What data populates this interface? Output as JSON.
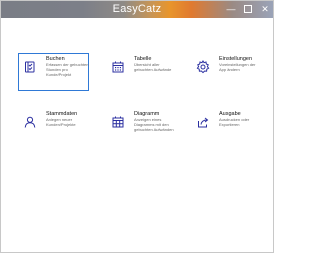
{
  "window": {
    "title": "EasyCatz",
    "minimize_glyph": "—",
    "close_glyph": "✕"
  },
  "colors": {
    "accent": "#2b2fa0",
    "selection_border": "#2f79d6"
  },
  "tiles": [
    {
      "label": "Buchen",
      "desc": "Erfassen der gebuchten Stunden pro Kunde/Projekt",
      "icon": "book-checklist-icon",
      "selected": true
    },
    {
      "label": "Tabelle",
      "desc": "Übersicht aller gebuchten Aufwände",
      "icon": "calendar-table-icon",
      "selected": false
    },
    {
      "label": "Einstellungen",
      "desc": "Voreinstellungen der App ändern",
      "icon": "gear-icon",
      "selected": false
    },
    {
      "label": "Stammdaten",
      "desc": "Anlegen neuer Kunden/Projekte",
      "icon": "person-icon",
      "selected": false
    },
    {
      "label": "Diagramm",
      "desc": "Anzeigen eines Diagramms mit den gebuchten Aufwänden",
      "icon": "calendar-grid-icon",
      "selected": false
    },
    {
      "label": "Ausgabe",
      "desc": "Ausdrucken oder Exportieren",
      "icon": "share-icon",
      "selected": false
    }
  ]
}
